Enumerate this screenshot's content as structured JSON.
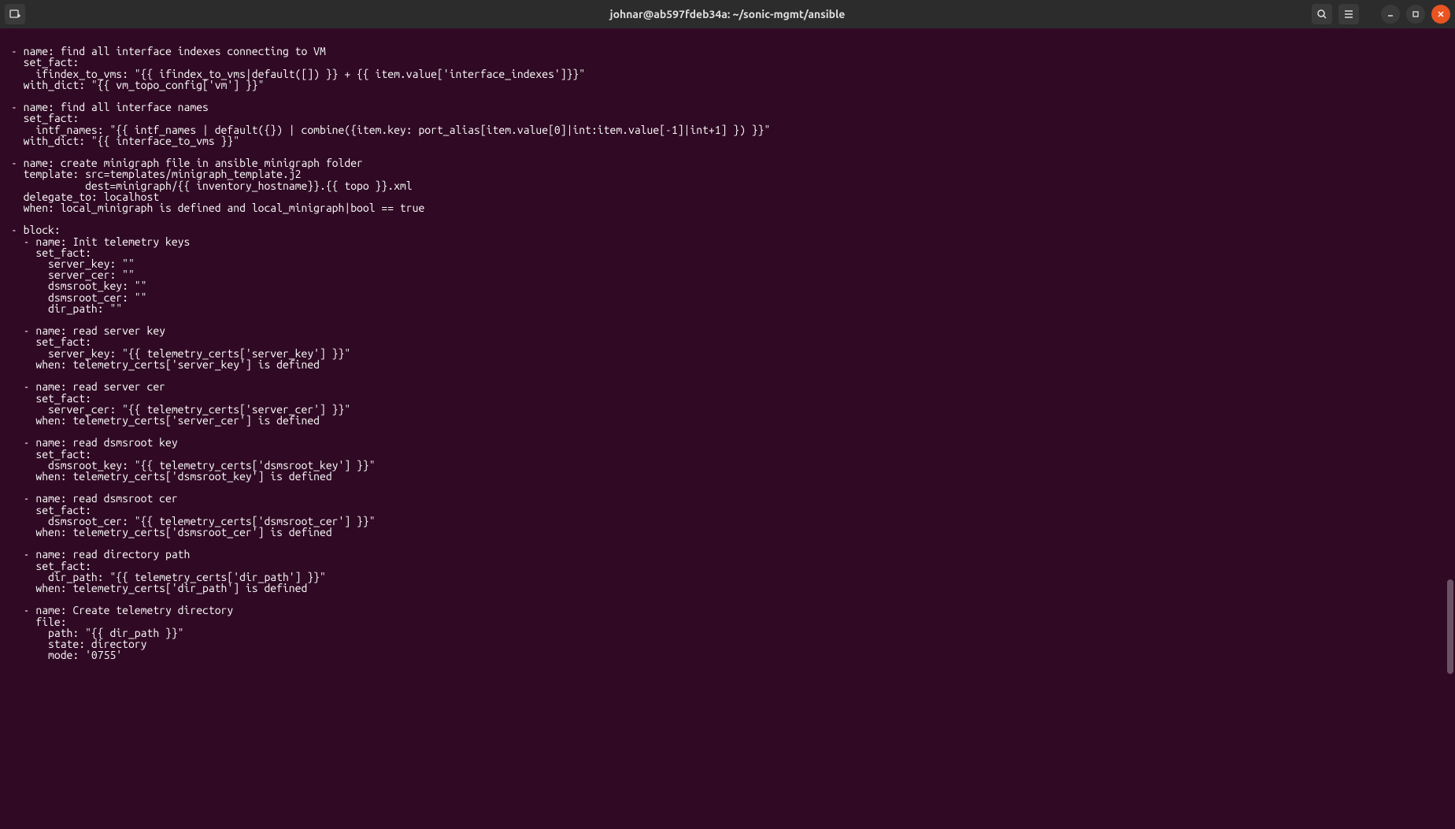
{
  "window": {
    "title": "johnar@ab597fdeb34a: ~/sonic-mgmt/ansible"
  },
  "terminal": {
    "content": "- name: find all interface indexes connecting to VM\n  set_fact:\n    ifindex_to_vms: \"{{ ifindex_to_vms|default([]) }} + {{ item.value['interface_indexes']}}\"\n  with_dict: \"{{ vm_topo_config['vm'] }}\"\n\n- name: find all interface names\n  set_fact:\n    intf_names: \"{{ intf_names | default({}) | combine({item.key: port_alias[item.value[0]|int:item.value[-1]|int+1] }) }}\"\n  with_dict: \"{{ interface_to_vms }}\"\n\n- name: create minigraph file in ansible minigraph folder\n  template: src=templates/minigraph_template.j2\n            dest=minigraph/{{ inventory_hostname}}.{{ topo }}.xml\n  delegate_to: localhost\n  when: local_minigraph is defined and local_minigraph|bool == true\n\n- block:\n  - name: Init telemetry keys\n    set_fact:\n      server_key: \"\"\n      server_cer: \"\"\n      dsmsroot_key: \"\"\n      dsmsroot_cer: \"\"\n      dir_path: \"\"\n\n  - name: read server key\n    set_fact:\n      server_key: \"{{ telemetry_certs['server_key'] }}\"\n    when: telemetry_certs['server_key'] is defined\n\n  - name: read server cer\n    set_fact:\n      server_cer: \"{{ telemetry_certs['server_cer'] }}\"\n    when: telemetry_certs['server_cer'] is defined\n\n  - name: read dsmsroot key\n    set_fact:\n      dsmsroot_key: \"{{ telemetry_certs['dsmsroot_key'] }}\"\n    when: telemetry_certs['dsmsroot_key'] is defined\n\n  - name: read dsmsroot cer\n    set_fact:\n      dsmsroot_cer: \"{{ telemetry_certs['dsmsroot_cer'] }}\"\n    when: telemetry_certs['dsmsroot_cer'] is defined\n\n  - name: read directory path\n    set_fact:\n      dir_path: \"{{ telemetry_certs['dir_path'] }}\"\n    when: telemetry_certs['dir_path'] is defined\n\n  - name: Create telemetry directory\n    file:\n      path: \"{{ dir_path }}\"\n      state: directory\n      mode: '0755'"
  }
}
